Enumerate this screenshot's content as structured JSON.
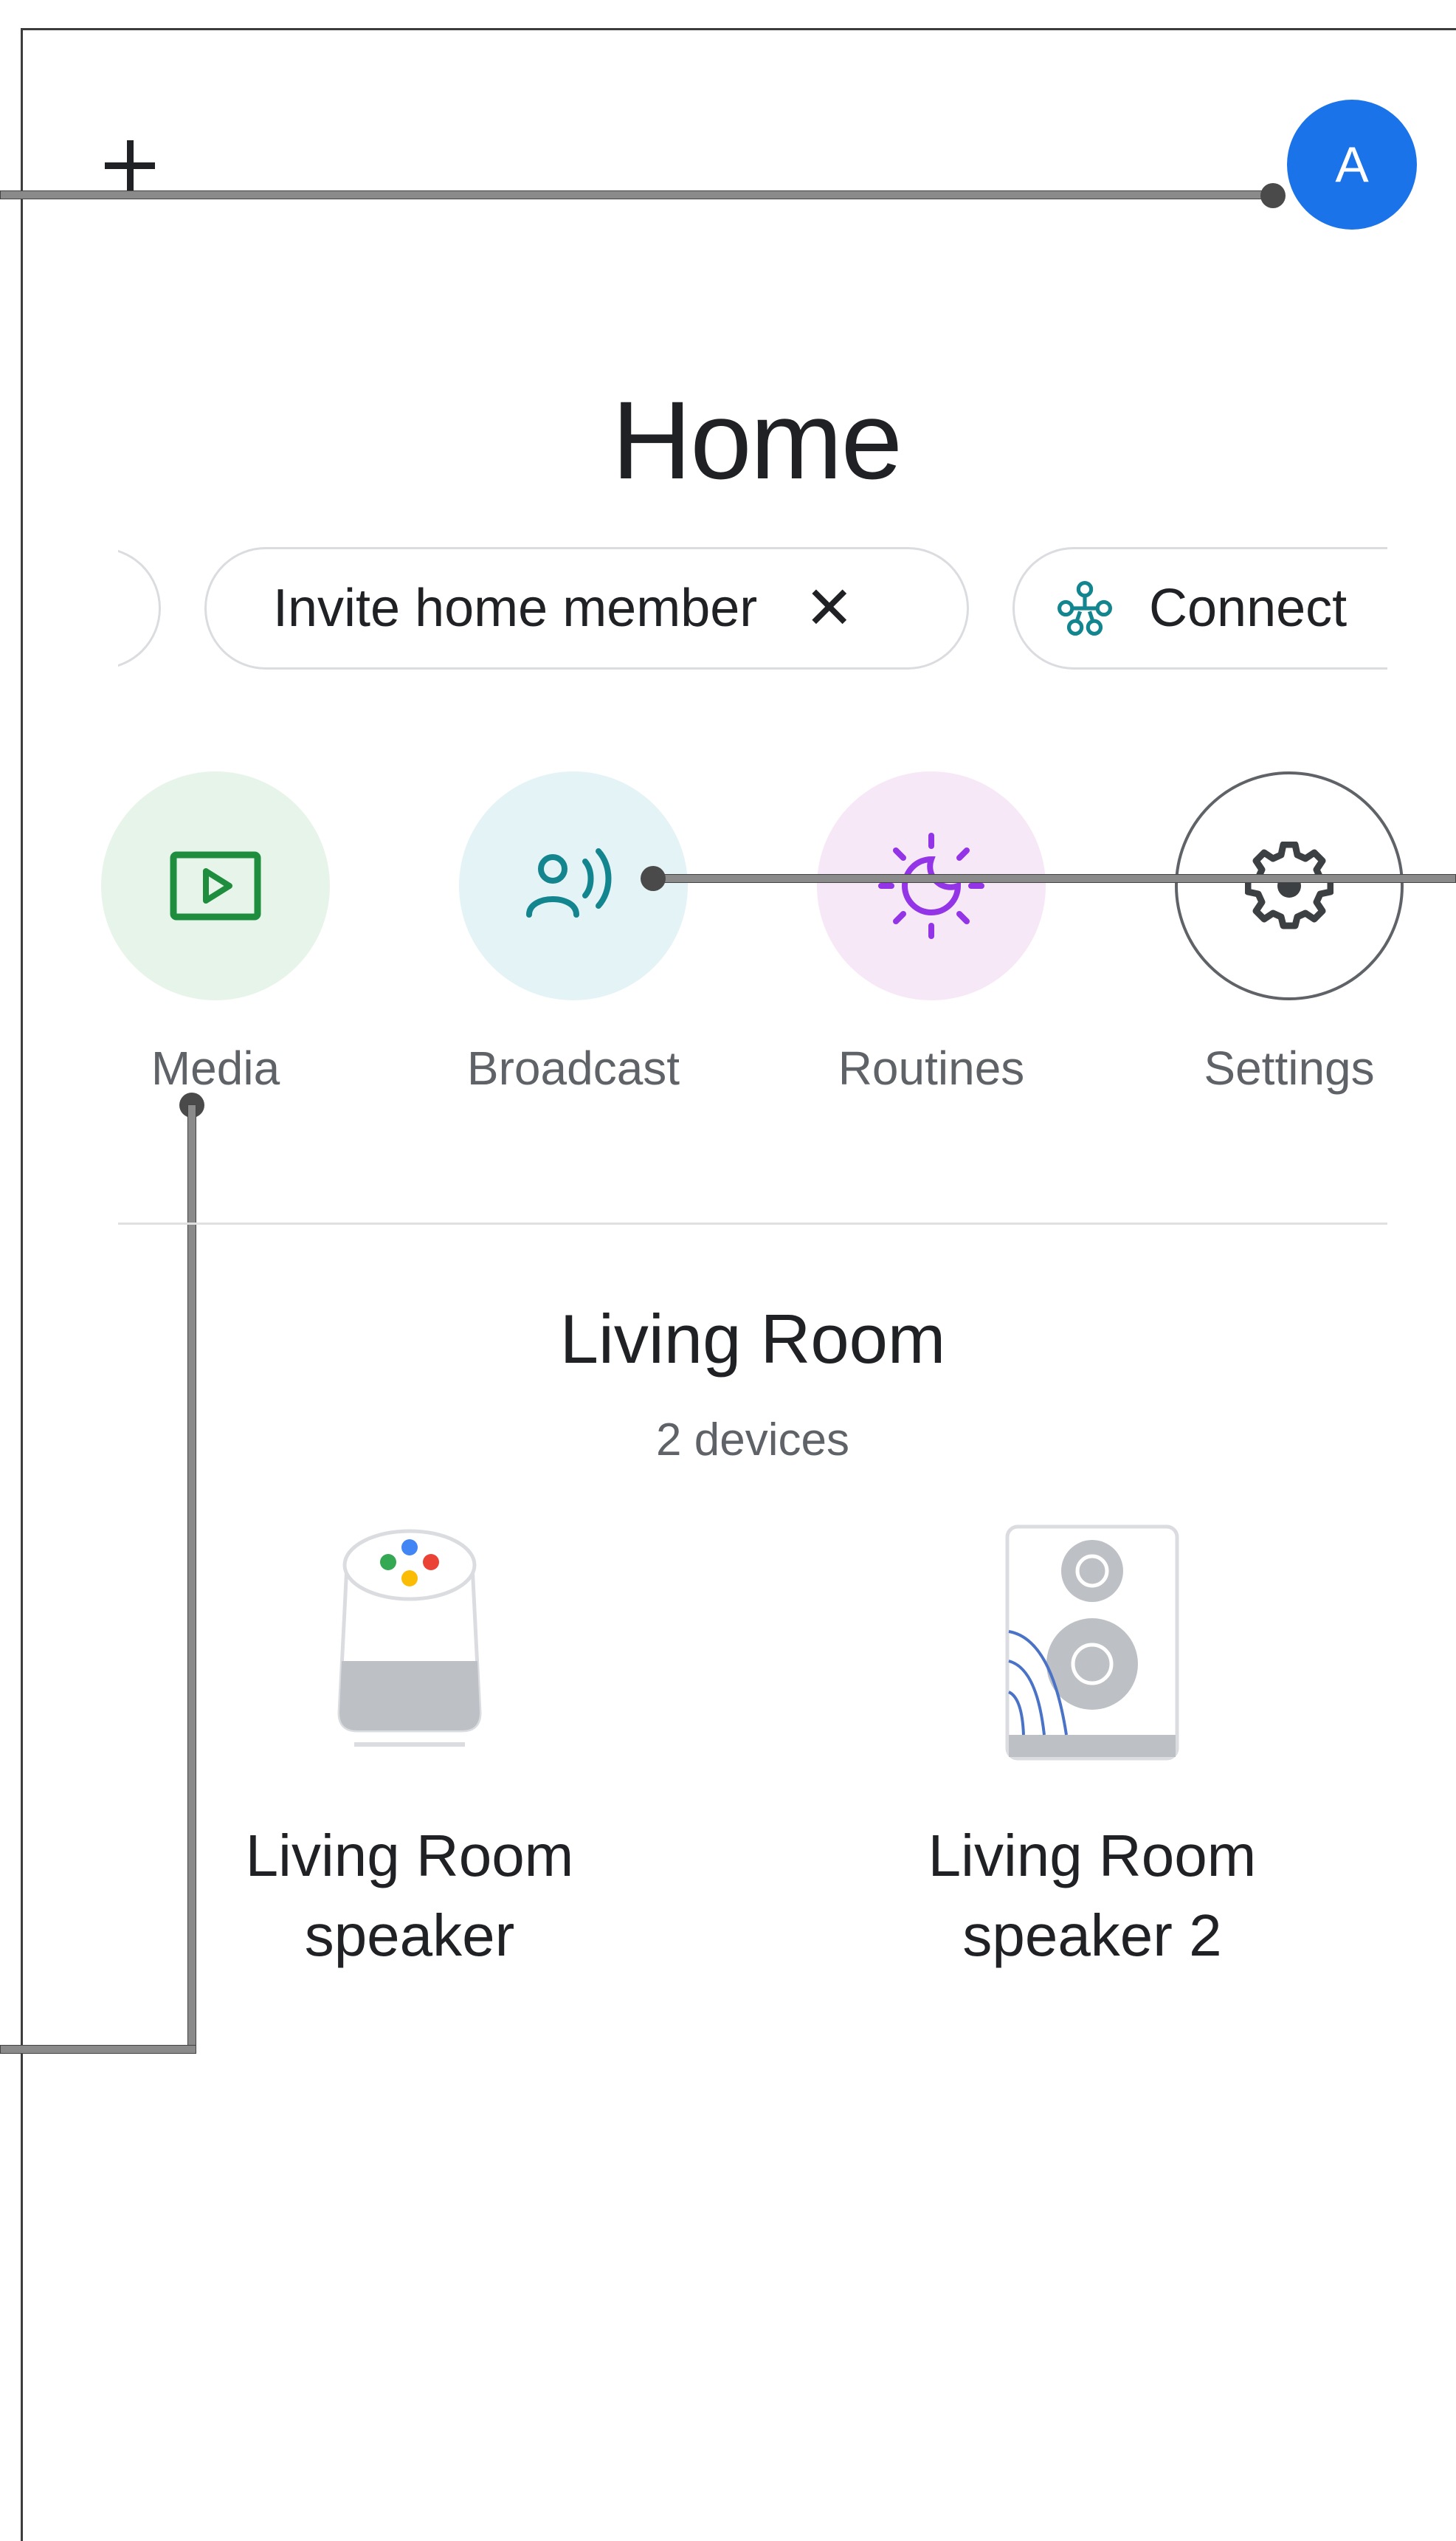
{
  "header": {
    "add_label": "+",
    "avatar_letter": "A"
  },
  "home": {
    "title": "Home"
  },
  "chips": {
    "invite_label": "Invite home member",
    "invite_close": "✕",
    "connect_label": "Connect"
  },
  "shortcuts": [
    {
      "label": "Media",
      "icon": "media-play-icon",
      "color": "#1e8e3e"
    },
    {
      "label": "Broadcast",
      "icon": "broadcast-icon",
      "color": "#12858f"
    },
    {
      "label": "Routines",
      "icon": "routines-sun-moon-icon",
      "color": "#9334e6"
    },
    {
      "label": "Settings",
      "icon": "gear-icon",
      "color": "#3c4043"
    }
  ],
  "room": {
    "name": "Living Room",
    "device_count": "2 devices",
    "devices": [
      {
        "line1": "Living Room",
        "line2": "speaker",
        "icon": "google-home-speaker-icon"
      },
      {
        "line1": "Living Room",
        "line2": "speaker 2",
        "icon": "speaker-cabinet-icon"
      }
    ]
  },
  "colors": {
    "accent": "#1a73e8",
    "text_primary": "#202124",
    "text_secondary": "#5f6368"
  }
}
